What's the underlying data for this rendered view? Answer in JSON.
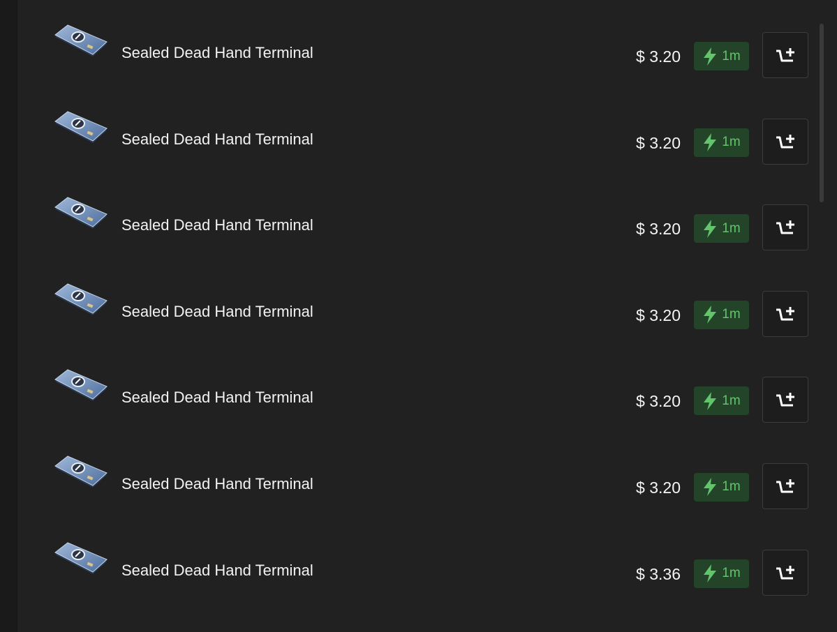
{
  "listings": [
    {
      "name": "Sealed Dead Hand Terminal",
      "price": "$ 3.20",
      "delivery_time": "1m"
    },
    {
      "name": "Sealed Dead Hand Terminal",
      "price": "$ 3.20",
      "delivery_time": "1m"
    },
    {
      "name": "Sealed Dead Hand Terminal",
      "price": "$ 3.20",
      "delivery_time": "1m"
    },
    {
      "name": "Sealed Dead Hand Terminal",
      "price": "$ 3.20",
      "delivery_time": "1m"
    },
    {
      "name": "Sealed Dead Hand Terminal",
      "price": "$ 3.20",
      "delivery_time": "1m"
    },
    {
      "name": "Sealed Dead Hand Terminal",
      "price": "$ 3.20",
      "delivery_time": "1m"
    },
    {
      "name": "Sealed Dead Hand Terminal",
      "price": "$ 3.36",
      "delivery_time": "1m"
    }
  ],
  "icons": {
    "item": "terminal-card-image",
    "delivery": "lightning-bolt-icon",
    "add": "add-to-cart-icon"
  },
  "colors": {
    "background": "#212121",
    "badge_background": "#24442a",
    "badge_accent": "#63c46c",
    "text": "#f2f2f2",
    "button_border": "#3c3c3c"
  }
}
